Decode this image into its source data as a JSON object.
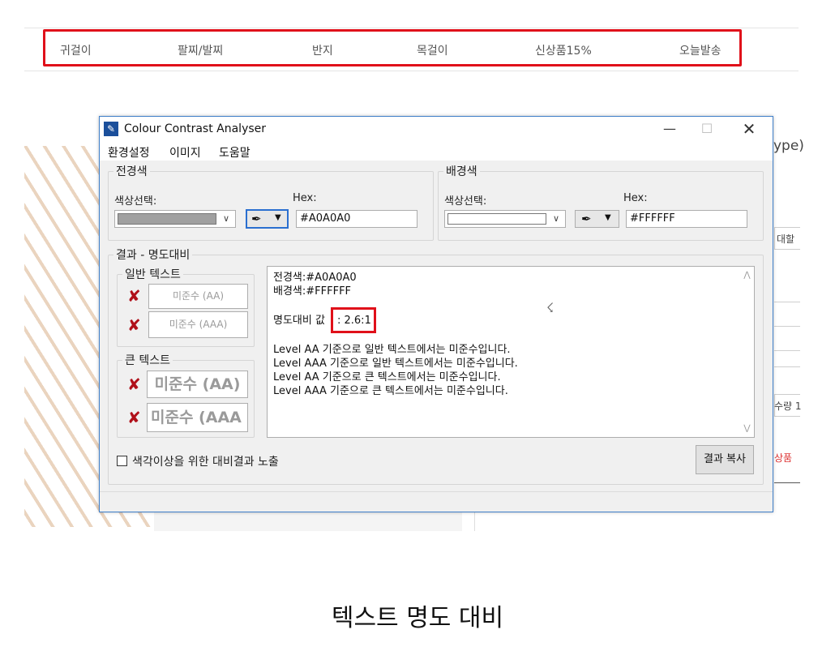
{
  "nav": {
    "items": [
      "귀걸이",
      "팔찌/발찌",
      "반지",
      "목걸이",
      "신상품15%",
      "오늘발송"
    ]
  },
  "background_page": {
    "fragments": [
      "ype)",
      "대할",
      "수량 1",
      "상품"
    ]
  },
  "window": {
    "title": "Colour Contrast Analyser",
    "menu": [
      "환경설정",
      "이미지",
      "도움말"
    ],
    "foreground": {
      "legend": "전경색",
      "select_label": "색상선택:",
      "hex_label": "Hex:",
      "hex_value": "#A0A0A0",
      "swatch_color": "#A0A0A0"
    },
    "background": {
      "legend": "배경색",
      "select_label": "색상선택:",
      "hex_label": "Hex:",
      "hex_value": "#FFFFFF",
      "swatch_color": "#FFFFFF"
    },
    "results": {
      "legend": "결과 - 명도대비",
      "normal_text": {
        "legend": "일반 텍스트",
        "aa": "미준수 (AA)",
        "aaa": "미준수 (AAA)"
      },
      "large_text": {
        "legend": "큰 텍스트",
        "aa": "미준수 (AA)",
        "aaa": "미준수 (AAA"
      },
      "fail_mark": "✘",
      "lines": {
        "fg": "전경색:#A0A0A0",
        "bg": "배경색:#FFFFFF",
        "ratio_label": "명도대비 값",
        "ratio_value": ": 2.6:1",
        "l1": "Level AA 기준으로 일반 텍스트에서는 미준수입니다.",
        "l2": "Level AAA 기준으로 일반 텍스트에서는 미준수입니다.",
        "l3": "Level AA 기준으로 큰 텍스트에서는 미준수입니다.",
        "l4": "Level AAA 기준으로 큰 텍스트에서는 미준수입니다."
      }
    },
    "colorblind_checkbox": "색각이상을 위한 대비결과 노출",
    "copy_button": "결과 복사"
  },
  "caption": "텍스트 명도 대비",
  "colors": {
    "highlight": "#e0101a",
    "fail": "#b0101a",
    "window_border": "#3f7fc9"
  }
}
